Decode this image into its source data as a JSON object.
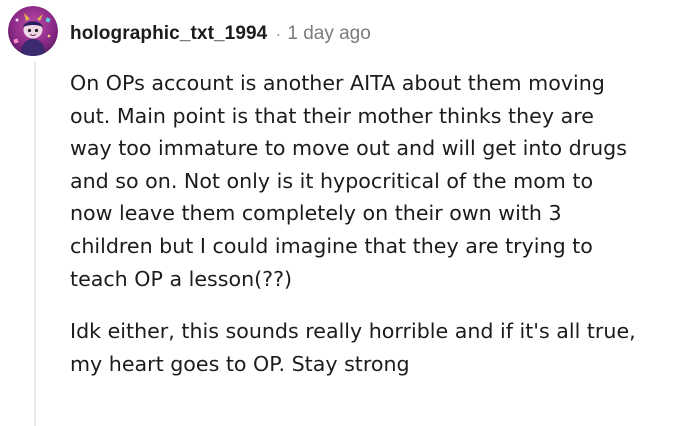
{
  "comment": {
    "author": "holographic_txt_1994",
    "separator": "·",
    "timestamp": "1 day ago",
    "avatar_icon": "snoo-avatar-icon",
    "accent_color": "#9b2a8a",
    "paragraphs": [
      {
        "lines": [
          "On OPs account is another AITA about them moving",
          "out. Main point is that their mother thinks they are",
          "way too immature to move out and will get into drugs",
          "and so on. Not only is it hypocritical of the mom to",
          "now leave them completely on their own with 3",
          "children but I could imagine that they are trying to",
          "teach OP a lesson(??)"
        ]
      },
      {
        "lines": [
          "Idk either, this sounds really horrible and if it's all true,",
          "my heart goes to OP. Stay strong"
        ]
      }
    ]
  }
}
